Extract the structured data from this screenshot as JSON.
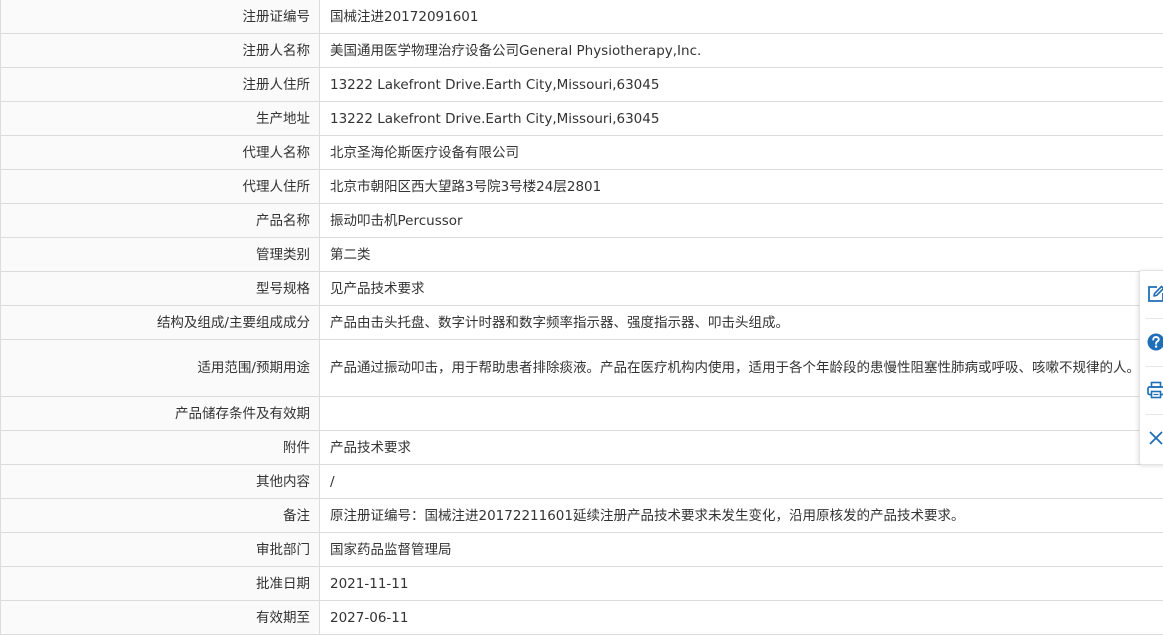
{
  "rows": [
    {
      "label": "注册证编号",
      "value": "国械注进20172091601"
    },
    {
      "label": "注册人名称",
      "value": "美国通用医学物理治疗设备公司General Physiotherapy,Inc."
    },
    {
      "label": "注册人住所",
      "value": "13222 Lakefront Drive.Earth City,Missouri,63045"
    },
    {
      "label": "生产地址",
      "value": "13222 Lakefront Drive.Earth City,Missouri,63045"
    },
    {
      "label": "代理人名称",
      "value": "北京圣海伦斯医疗设备有限公司"
    },
    {
      "label": "代理人住所",
      "value": "北京市朝阳区西大望路3号院3号楼24层2801"
    },
    {
      "label": "产品名称",
      "value": "振动叩击机Percussor"
    },
    {
      "label": "管理类别",
      "value": "第二类"
    },
    {
      "label": "型号规格",
      "value": "见产品技术要求"
    },
    {
      "label": "结构及组成/主要组成成分",
      "value": "产品由击头托盘、数字计时器和数字频率指示器、强度指示器、叩击头组成。"
    },
    {
      "label": "适用范围/预期用途",
      "value": "产品通过振动叩击，用于帮助患者排除痰液。产品在医疗机构内使用，适用于各个年龄段的患慢性阻塞性肺病或呼吸、咳嗽不规律的人。"
    },
    {
      "label": "产品储存条件及有效期",
      "value": ""
    },
    {
      "label": "附件",
      "value": "产品技术要求"
    },
    {
      "label": "其他内容",
      "value": "/"
    },
    {
      "label": "备注",
      "value": "原注册证编号：国械注进20172211601延续注册产品技术要求未发生变化，沿用原核发的产品技术要求。"
    },
    {
      "label": "审批部门",
      "value": "国家药品监督管理局"
    },
    {
      "label": "批准日期",
      "value": "2021-11-11"
    },
    {
      "label": "有效期至",
      "value": "2027-06-11"
    }
  ],
  "toolbar": {
    "icons": [
      "edit-icon",
      "help-icon",
      "print-icon",
      "close-icon"
    ],
    "accent_color": "#1f6fb8"
  }
}
